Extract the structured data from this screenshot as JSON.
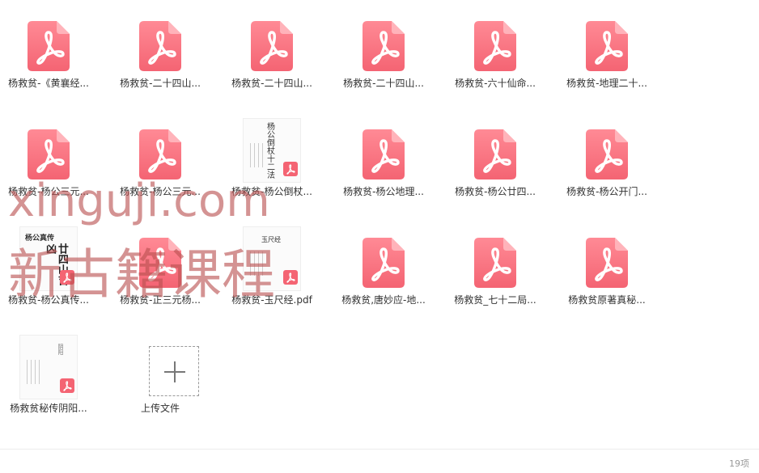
{
  "files": [
    {
      "name": "杨救贫-《黄襄经...",
      "thumb": "pdf-icon"
    },
    {
      "name": "杨救贫-二十四山...",
      "thumb": "pdf-icon"
    },
    {
      "name": "杨救贫-二十四山...",
      "thumb": "pdf-icon"
    },
    {
      "name": "杨救贫-二十四山...",
      "thumb": "pdf-icon"
    },
    {
      "name": "杨救贫-六十仙命...",
      "thumb": "pdf-icon"
    },
    {
      "name": "杨救贫-地理二十...",
      "thumb": "pdf-icon"
    },
    {
      "name": "杨救贫-杨公三元...",
      "thumb": "pdf-icon"
    },
    {
      "name": "杨救贫-杨公三元...",
      "thumb": "pdf-icon"
    },
    {
      "name": "杨救贫-杨公倒杖...",
      "thumb": "doc-thumb",
      "doc_text": "杨公倒杖十二法"
    },
    {
      "name": "杨救贫-杨公地理...",
      "thumb": "pdf-icon"
    },
    {
      "name": "杨救贫-杨公廿四...",
      "thumb": "pdf-icon"
    },
    {
      "name": "杨救贫-杨公开门...",
      "thumb": "pdf-icon"
    },
    {
      "name": "杨救贫-杨公真传...",
      "thumb": "doc-thumb",
      "doc_text": "杨公真传",
      "doc_text2": "廿四山吉凶"
    },
    {
      "name": "杨救贫-正三元杨...",
      "thumb": "pdf-icon"
    },
    {
      "name": "杨救贫-玉尺经.pdf",
      "thumb": "doc-thumb",
      "doc_text": "玉尺经"
    },
    {
      "name": "杨救贫,唐妙应-地...",
      "thumb": "pdf-icon"
    },
    {
      "name": "杨救贫_七十二局...",
      "thumb": "pdf-icon"
    },
    {
      "name": "杨救贫原著真秘...",
      "thumb": "pdf-icon"
    },
    {
      "name": "杨救贫秘传阴阳...",
      "thumb": "doc-thumb",
      "doc_text": "阴阳"
    }
  ],
  "upload": {
    "label": "上传文件",
    "icon": "plus-icon"
  },
  "footer": {
    "count": "19项"
  },
  "watermark": {
    "line1": "xinguji.com",
    "line2": "新古籍课程"
  },
  "colors": {
    "pdf": "#f56c7a",
    "pdf_light": "#ff8e99"
  }
}
